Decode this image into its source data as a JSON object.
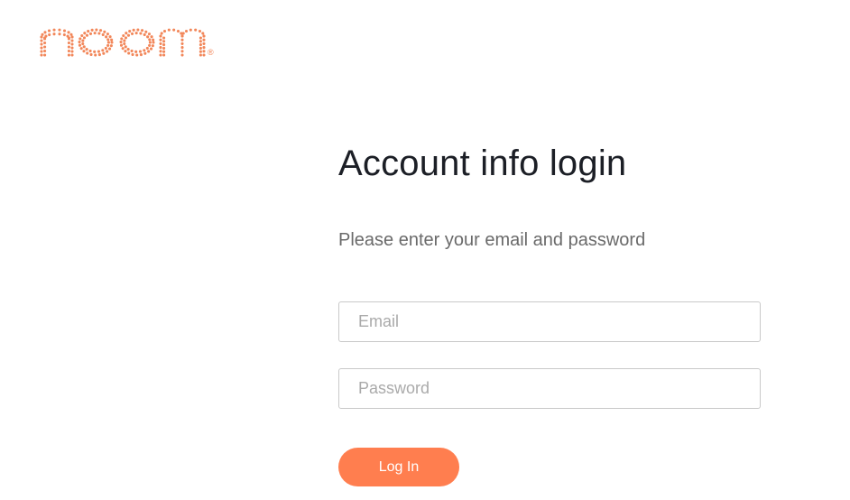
{
  "brand": {
    "logo_text": "noom",
    "registered_mark": "®",
    "color": "#f2875a"
  },
  "login": {
    "title": "Account info login",
    "subtitle": "Please enter your email and password",
    "email_placeholder": "Email",
    "email_value": "",
    "password_placeholder": "Password",
    "password_value": "",
    "button_label": "Log In",
    "button_color": "#ff7e4f"
  }
}
